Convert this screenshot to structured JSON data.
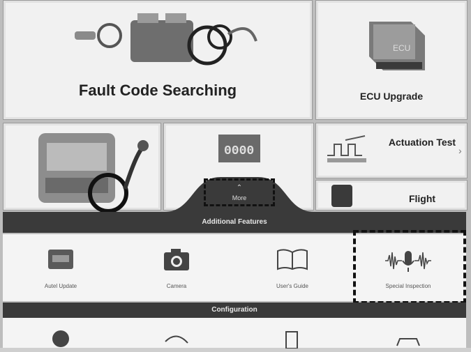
{
  "tiles": {
    "fault_code_searching": "Fault Code Searching",
    "ecu_upgrade": "ECU Upgrade",
    "actuation_test": "Actuation Test",
    "flight": "Flight"
  },
  "more": {
    "label": "More"
  },
  "sections": {
    "additional_features": "Additional Features",
    "configuration": "Configuration"
  },
  "features": [
    {
      "label": "Autel Update",
      "icon": "vci-update-icon"
    },
    {
      "label": "Camera",
      "icon": "camera-icon"
    },
    {
      "label": "User's Guide",
      "icon": "book-icon"
    },
    {
      "label": "Special Inspection",
      "icon": "voice-mic-icon"
    }
  ],
  "ecu_icon_text": "ECU",
  "display_text": "0000"
}
